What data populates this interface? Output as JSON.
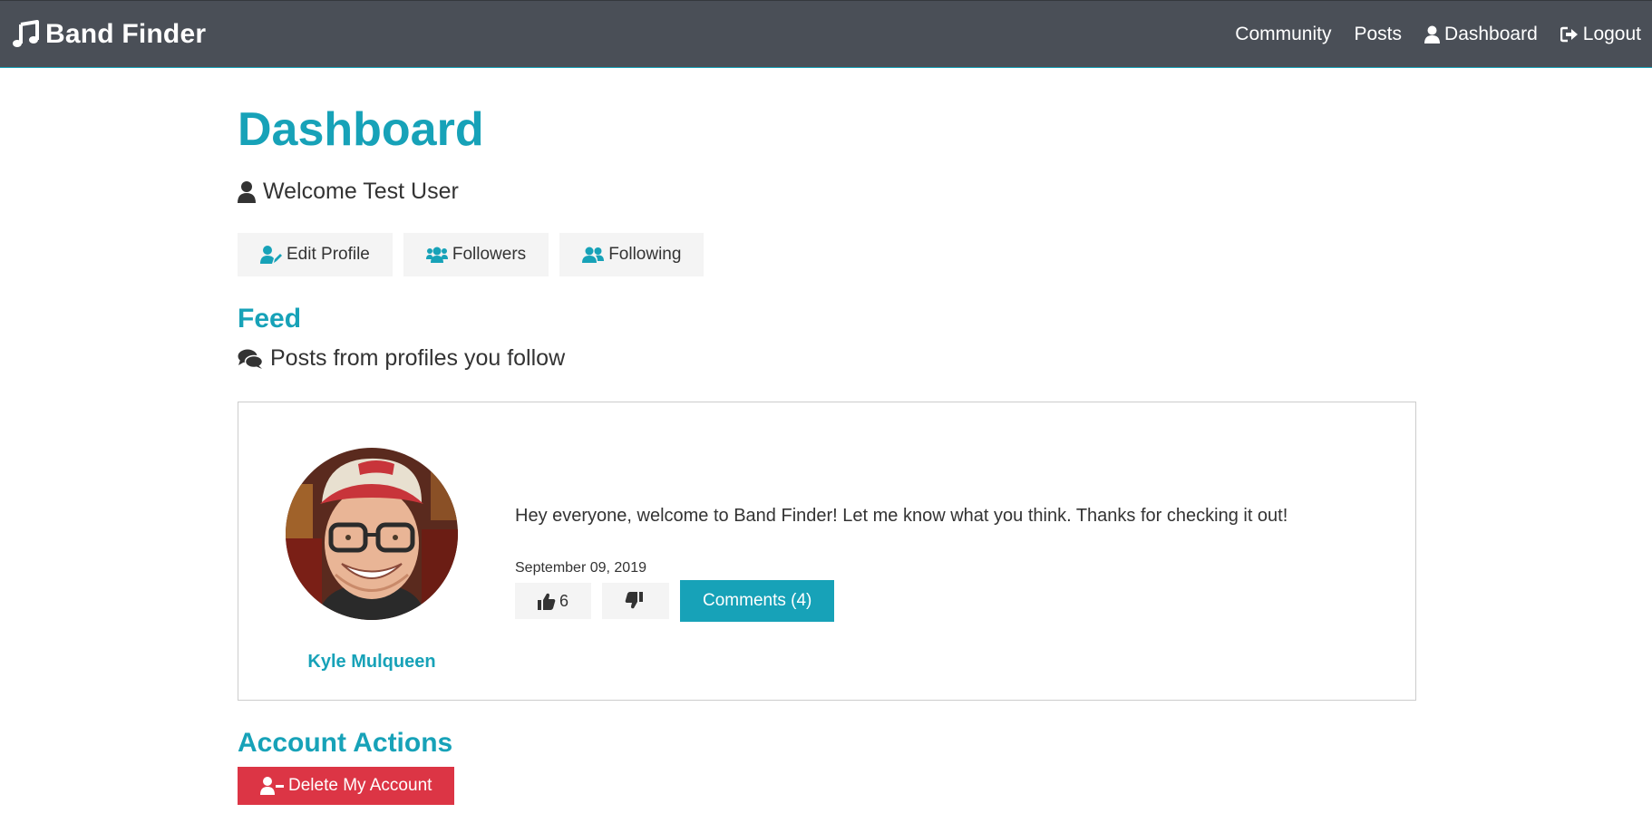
{
  "navbar": {
    "brand": "Band Finder",
    "links": {
      "community": "Community",
      "posts": "Posts",
      "dashboard": "Dashboard",
      "logout": "Logout"
    }
  },
  "page": {
    "title": "Dashboard",
    "welcome": "Welcome Test User"
  },
  "profile_buttons": {
    "edit_profile": "Edit Profile",
    "followers": "Followers",
    "following": "Following"
  },
  "feed": {
    "title": "Feed",
    "subtitle": "Posts from profiles you follow",
    "posts": [
      {
        "author": "Kyle Mulqueen",
        "text": "Hey everyone, welcome to Band Finder! Let me know what you think. Thanks for checking it out!",
        "date": "September 09, 2019",
        "likes": "6",
        "comments_label": "Comments (4)"
      }
    ]
  },
  "account": {
    "title": "Account Actions",
    "delete_label": "Delete My Account"
  },
  "colors": {
    "navbar_bg": "#4a4f57",
    "accent": "#17a2b8",
    "danger": "#dc3545",
    "light_button": "#f4f4f4"
  },
  "icons": {
    "brand": "music-note-icon",
    "dashboard": "user-icon",
    "logout": "sign-out-icon",
    "welcome": "user-icon",
    "edit_profile": "user-edit-icon",
    "followers": "users-icon",
    "following": "user-friends-icon",
    "feed": "comments-icon",
    "like": "thumbs-up-icon",
    "dislike": "thumbs-down-icon",
    "delete": "user-minus-icon"
  }
}
